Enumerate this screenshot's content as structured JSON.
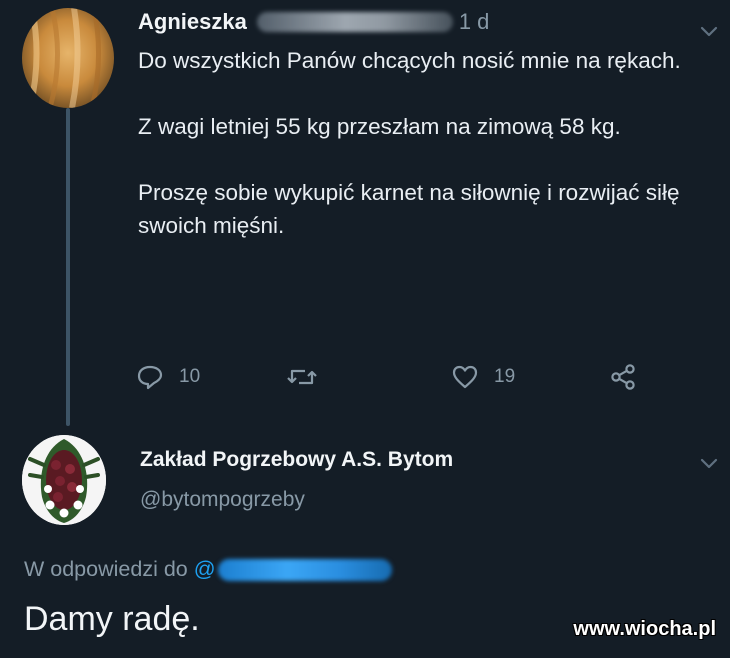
{
  "tweet": {
    "author_name": "Agnieszka",
    "time": "1 d",
    "paragraphs": [
      "Do wszystkich Panów chcących nosić mnie na rękach.",
      "Z wagi letniej 55 kg przeszłam na zimową 58 kg.",
      "Proszę sobie wykupić karnet na siłownię i rozwijać siłę swoich mięśni."
    ],
    "actions": {
      "reply_count": "10",
      "like_count": "19"
    }
  },
  "reply": {
    "author_name": "Zakład Pogrzebowy A.S. Bytom",
    "author_handle": "@bytompogrzeby",
    "reply_to_label": "W odpowiedzi do",
    "reply_to_at": "@",
    "text": "Damy radę."
  },
  "watermark": "www.wiocha.pl",
  "colors": {
    "background": "#141d26",
    "text": "#e9eef3",
    "muted": "#8899a6",
    "link": "#1da1f2"
  }
}
